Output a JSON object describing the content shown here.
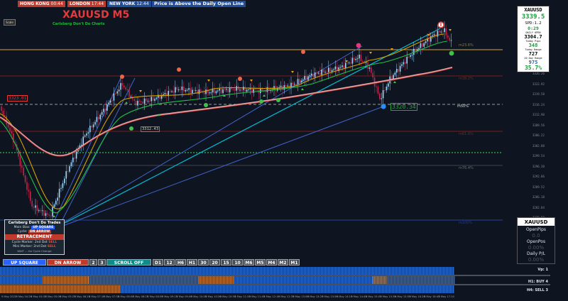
{
  "sessions": [
    {
      "city": "HONG KONG",
      "time": "00:44",
      "bg": "#c0392b"
    },
    {
      "city": "LONDON",
      "time": "17:44",
      "bg": "#c0392b"
    },
    {
      "city": "NEW YORK",
      "time": "12:44",
      "bg": "#1f4d9c"
    }
  ],
  "status_message": "Price is Above the Daily Open Line",
  "chart_title": "XAUUSD M5",
  "chart_subtitle": "Carlsberg Don't Do Charts",
  "scale_button": "Scale",
  "price_labels": {
    "left_marker": "3323.01",
    "mid_marker": "3320.34",
    "low_marker": "3312.43",
    "fib_23": "m23.6%",
    "fib_38": "m38.2%",
    "fib_50": "m50%",
    "fib_61": "m61.8%",
    "fib_76": "m76.4%",
    "fib_100": "m100%"
  },
  "info_panel": {
    "symbol": "XAUUSD",
    "price": "3339.5",
    "spread": "SPD:1.2",
    "countdown": "0:29",
    "daily_open_label": "DAILY OPEN",
    "daily_open": "3304.7",
    "today_pips_label": "Today Pips",
    "today_pips": "348",
    "today_range_label": "Today Range",
    "today_range": "727",
    "day20_label": "20 Day Range",
    "day20": "975",
    "percent": "35.7%"
  },
  "open_pips_panel": {
    "symbol": "XAUUSD",
    "open_pips_label": "OpenPips",
    "open_pips": "0.0",
    "open_pos_label": "OpenPos",
    "open_pos": "0.00%",
    "daily_pl_label": "Daily P/L",
    "daily_pl": "0.00%"
  },
  "carlsberg_panel": {
    "title": "Carlsberg Don't Do Trades",
    "main_bias_label": "Main Bias:",
    "main_bias": "UP SQUARE",
    "cycle_label": "Cycle:",
    "cycle": "DN ARROW",
    "status": "RETRACEMENT",
    "cycle_marker_label": "Cycle Marker: 2nd Dot",
    "cycle_marker": "SELL",
    "mini_marker_label": "Mini Marker: 2nd Dot",
    "mini_marker": "SELL",
    "footer": "WAIT ... for Cycle Change"
  },
  "bottom_bar": {
    "up_square": "UP SQUARE",
    "dn_arrow": "DN ARROW",
    "num2": "2",
    "num3": "3",
    "scroll": "SCROLL OFF",
    "timeframes": [
      "D1",
      "12",
      "H6",
      "H1",
      "30",
      "20",
      "15",
      "10",
      "M6",
      "M5",
      "M4",
      "M2",
      "M1"
    ]
  },
  "strength_rows": {
    "row1_label": "Vp: 1",
    "row2_label": "H1: BUY 4",
    "row3_label": "H4: SELL 3"
  },
  "time_axis": [
    "9 May 2025",
    "9 May 04:20",
    "9 May 04:35",
    "9 May 05:00",
    "9 May 05:25",
    "9 May 06:10",
    "9 May 07:10",
    "9 May 07:35",
    "9 May 08:00",
    "9 May 08:25",
    "9 May 08:50",
    "9 May 09:15",
    "9 May 09:40",
    "9 May 10:05",
    "9 May 10:30",
    "9 May 10:55",
    "9 May 11:20",
    "9 May 11:45",
    "9 May 12:10",
    "9 May 12:35",
    "9 May 13:00",
    "9 May 13:25",
    "9 May 13:50",
    "9 May 14:15",
    "9 May 14:40",
    "9 May 15:05",
    "9 May 15:30",
    "9 May 15:55",
    "9 May 16:20",
    "9 May 16:45",
    "9 May 17:10"
  ],
  "price_axis": [
    "3346.30",
    "3342.96",
    "3339.62",
    "3336.28",
    "3332.94",
    "3329.60",
    "3326.26",
    "3322.92",
    "3319.58",
    "3316.24",
    "3312.90",
    "3309.56",
    "3306.22",
    "3302.88",
    "3299.54",
    "3296.20",
    "3292.86",
    "3289.52",
    "3286.18",
    "3282.84",
    "3279.50",
    "3276.16",
    "3272.82",
    "3269.48"
  ],
  "chart_data": {
    "type": "candlestick",
    "symbol": "XAUUSD",
    "timeframe": "M5",
    "title": "XAUUSD M5",
    "ylim": [
      3268,
      3348
    ],
    "x_range": [
      "9 May 2025",
      "9 May 17:10"
    ],
    "levels": [
      {
        "label": "m23.6%",
        "price": 3336.3,
        "color": "#d4a73a"
      },
      {
        "label": "m38.2%",
        "price": 3330.0,
        "color": "#8b1c1c"
      },
      {
        "label": "m50%",
        "price": 3320.34,
        "color": "#c8c8c8"
      },
      {
        "label": "m61.8%",
        "price": 3313.0,
        "color": "#8b1c1c"
      },
      {
        "label": "m76.4%",
        "price": 3305.0,
        "color": "#555555"
      },
      {
        "label": "m100%",
        "price": 3283.5,
        "color": "#1e3a8a"
      }
    ],
    "markers": [
      {
        "label": "3323.01",
        "price": 3323.01
      },
      {
        "label": "3320.34",
        "price": 3320.34
      },
      {
        "label": "3312.43",
        "price": 3312.43
      }
    ],
    "current_price": 3339.5,
    "grid": false
  }
}
